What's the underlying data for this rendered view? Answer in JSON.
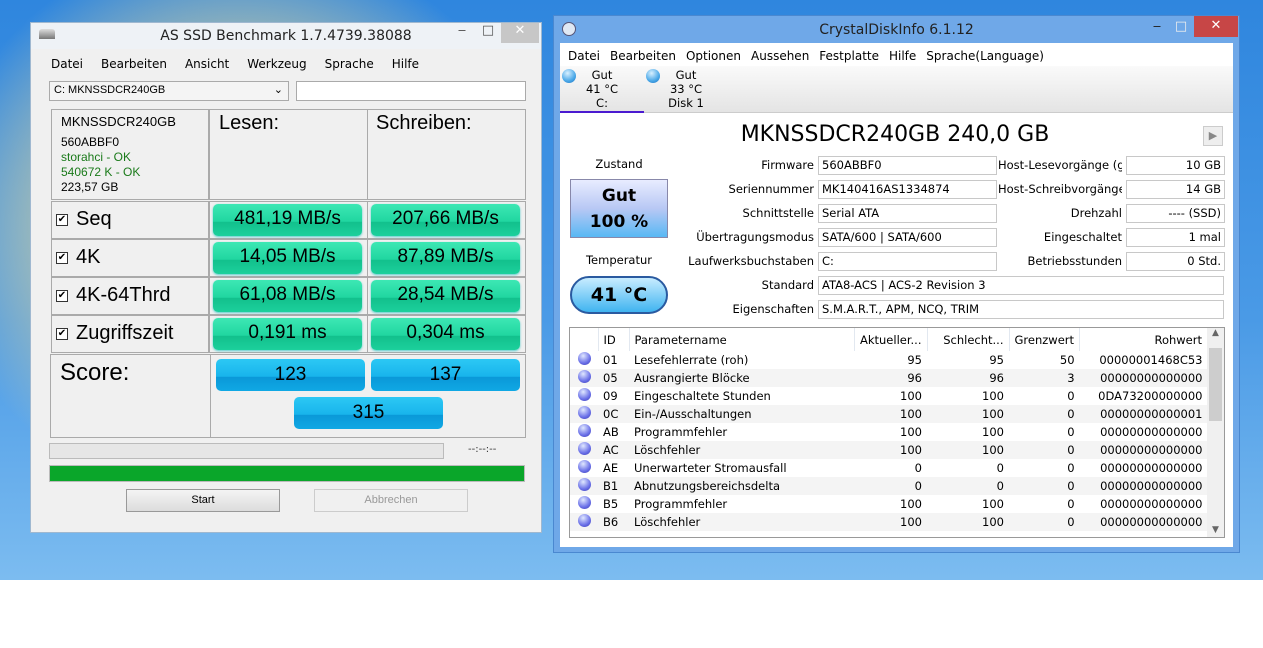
{
  "asssd": {
    "title": "AS SSD Benchmark 1.7.4739.38088",
    "menu": [
      "Datei",
      "Bearbeiten",
      "Ansicht",
      "Werkzeug",
      "Sprache",
      "Hilfe"
    ],
    "drive_select": "C: MKNSSDCR240GB",
    "text_field": "",
    "info": {
      "model": "MKNSSDCR240GB",
      "firmware": "560ABBF0",
      "driver": "storahci - OK",
      "alignment": "540672 K - OK",
      "size": "223,57 GB"
    },
    "headers": {
      "read": "Lesen:",
      "write": "Schreiben:"
    },
    "rows": [
      {
        "label": "Seq",
        "checked": true,
        "read": "481,19 MB/s",
        "write": "207,66 MB/s"
      },
      {
        "label": "4K",
        "checked": true,
        "read": "14,05 MB/s",
        "write": "87,89 MB/s"
      },
      {
        "label": "4K-64Thrd",
        "checked": true,
        "read": "61,08 MB/s",
        "write": "28,54 MB/s"
      },
      {
        "label": "Zugriffszeit",
        "checked": true,
        "read": "0,191 ms",
        "write": "0,304 ms"
      }
    ],
    "score": {
      "label": "Score:",
      "read": "123",
      "write": "137",
      "total": "315"
    },
    "time": "--:--:--",
    "progress_percent": 100,
    "buttons": {
      "start": "Start",
      "cancel": "Abbrechen"
    },
    "accent": "#0aa62a"
  },
  "cdi": {
    "title": "CrystalDiskInfo 6.1.12",
    "menu": [
      "Datei",
      "Bearbeiten",
      "Optionen",
      "Aussehen",
      "Festplatte",
      "Hilfe",
      "Sprache(Language)"
    ],
    "disks": [
      {
        "status": "Gut",
        "temp": "41 °C",
        "name": "C:"
      },
      {
        "status": "Gut",
        "temp": "33 °C",
        "name": "Disk 1"
      }
    ],
    "heading": "MKNSSDCR240GB 240,0 GB",
    "zustand_label": "Zustand",
    "health_status": "Gut",
    "health_percent": "100 %",
    "temp_label": "Temperatur",
    "temp": "41 °C",
    "fields": [
      {
        "label": "Firmware",
        "value": "560ABBF0"
      },
      {
        "label": "Seriennummer",
        "value": "MK140416AS1334874"
      },
      {
        "label": "Schnittstelle",
        "value": "Serial ATA"
      },
      {
        "label": "Übertragungsmodus",
        "value": "SATA/600 | SATA/600"
      },
      {
        "label": "Laufwerksbuchstaben",
        "value": "C:"
      },
      {
        "label": "Standard",
        "value": "ATA8-ACS | ACS-2 Revision 3"
      },
      {
        "label": "Eigenschaften",
        "value": "S.M.A.R.T., APM, NCQ, TRIM"
      }
    ],
    "right_fields": [
      {
        "label": "Host-Lesevorgänge (ge",
        "value": "10 GB"
      },
      {
        "label": "Host-Schreibvorgänge (",
        "value": "14 GB"
      },
      {
        "label": "Drehzahl",
        "value": "---- (SSD)"
      },
      {
        "label": "Eingeschaltet",
        "value": "1 mal"
      },
      {
        "label": "Betriebsstunden",
        "value": "0 Std."
      }
    ],
    "columns": [
      "ID",
      "Parametername",
      "Aktueller...",
      "Schlecht...",
      "Grenzwert",
      "Rohwert"
    ],
    "smart": [
      [
        "01",
        "Lesefehlerrate (roh)",
        "95",
        "95",
        "50",
        "00000001468C53"
      ],
      [
        "05",
        "Ausrangierte Blöcke",
        "96",
        "96",
        "3",
        "00000000000000"
      ],
      [
        "09",
        "Eingeschaltete Stunden",
        "100",
        "100",
        "0",
        "0DA73200000000"
      ],
      [
        "0C",
        "Ein-/Ausschaltungen",
        "100",
        "100",
        "0",
        "00000000000001"
      ],
      [
        "AB",
        "Programmfehler",
        "100",
        "100",
        "0",
        "00000000000000"
      ],
      [
        "AC",
        "Löschfehler",
        "100",
        "100",
        "0",
        "00000000000000"
      ],
      [
        "AE",
        "Unerwarteter Stromausfall",
        "0",
        "0",
        "0",
        "00000000000000"
      ],
      [
        "B1",
        "Abnutzungsbereichsdelta",
        "0",
        "0",
        "0",
        "00000000000000"
      ],
      [
        "B5",
        "Programmfehler",
        "100",
        "100",
        "0",
        "00000000000000"
      ],
      [
        "B6",
        "Löschfehler",
        "100",
        "100",
        "0",
        "00000000000000"
      ]
    ]
  }
}
